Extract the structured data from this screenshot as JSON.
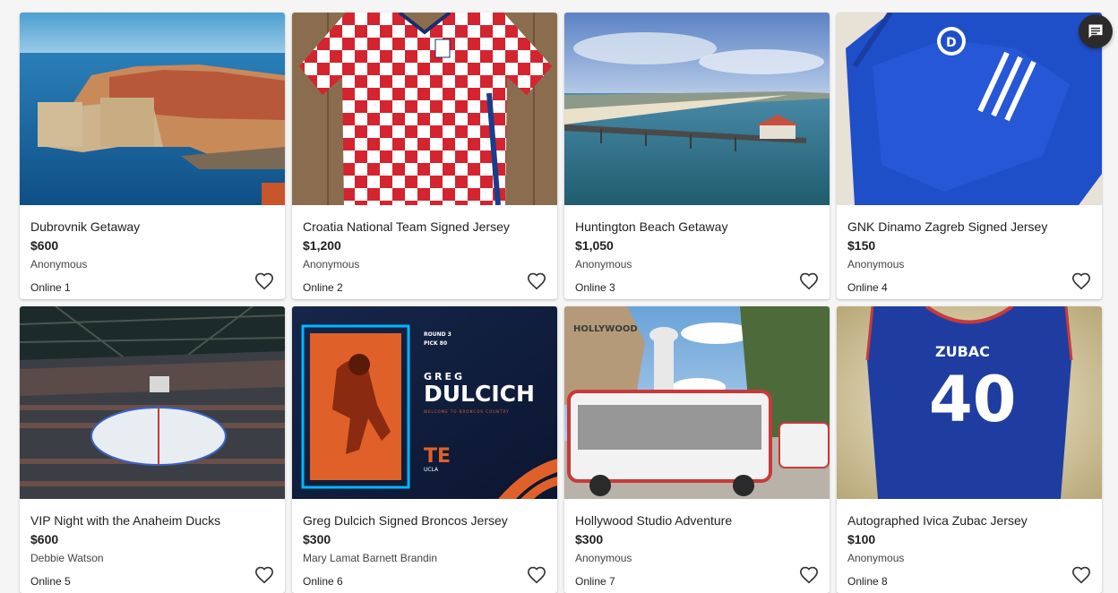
{
  "items": [
    {
      "title": "Dubrovnik Getaway",
      "price": "$600",
      "donor": "Anonymous",
      "lot": "Online 1",
      "image_label": "dubrovnik-photo"
    },
    {
      "title": "Croatia National Team Signed Jersey",
      "price": "$1,200",
      "donor": "Anonymous",
      "lot": "Online 2",
      "image_label": "croatia-jersey-photo"
    },
    {
      "title": "Huntington Beach Getaway",
      "price": "$1,050",
      "donor": "Anonymous",
      "lot": "Online 3",
      "image_label": "huntington-beach-photo"
    },
    {
      "title": "GNK Dinamo Zagreb Signed Jersey",
      "price": "$150",
      "donor": "Anonymous",
      "lot": "Online 4",
      "image_label": "dinamo-jersey-photo"
    },
    {
      "title": "VIP Night with the Anaheim Ducks",
      "price": "$600",
      "donor": "Debbie Watson",
      "lot": "Online 5",
      "image_label": "hockey-arena-photo"
    },
    {
      "title": "Greg Dulcich Signed Broncos Jersey",
      "price": "$300",
      "donor": "Mary Lamat Barnett Brandin",
      "lot": "Online 6",
      "image_label": "dulcich-graphic"
    },
    {
      "title": "Hollywood Studio Adventure",
      "price": "$300",
      "donor": "Anonymous",
      "lot": "Online 7",
      "image_label": "studio-tour-photo"
    },
    {
      "title": "Autographed Ivica Zubac Jersey",
      "price": "$100",
      "donor": "Anonymous",
      "lot": "Online 8",
      "image_label": "zubac-jersey-photo"
    }
  ],
  "graphic_text": {
    "round": "ROUND 3",
    "pick": "PICK 80",
    "first": "GREG",
    "last": "DULCICH",
    "tagline": "WELCOME TO BRONCOS COUNTRY",
    "position": "TE",
    "school": "UCLA",
    "jersey_name": "ZUBAC",
    "jersey_number": "40",
    "studio_sign": "HOLLYWOOD"
  },
  "icons": {
    "favorite": "heart-outline-icon",
    "chat": "chat-icon"
  },
  "colors": {
    "background": "#f5f5f5",
    "card": "#ffffff",
    "text": "#212121",
    "chat_button": "#2b2b2b"
  }
}
